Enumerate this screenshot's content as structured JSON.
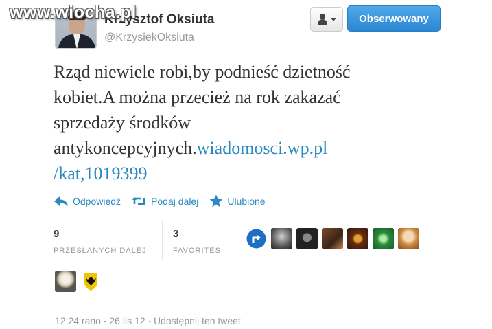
{
  "watermark": "www.wiocha.pl",
  "user": {
    "name": "Krzysztof Oksiuta",
    "handle": "@KrzysiekOksiuta"
  },
  "buttons": {
    "follow_label": "Obserwowany"
  },
  "icons": [
    "person-icon",
    "caret-down-icon",
    "reply-icon",
    "retweet-icon",
    "star-icon"
  ],
  "tweet": {
    "text": "Rząd niewiele robi,by podnieść dzietność kobiet.A można przecież na rok zakazać sprzedaży środków antykoncepcyjnych.",
    "link": "wiadomosci.wp.pl /kat,1019399"
  },
  "actions": {
    "reply": "Odpowiedź",
    "retweet": "Podaj dalej",
    "favorite": "Ulubione"
  },
  "stats": {
    "retweets": {
      "count": "9",
      "label": "PRZESŁANYCH DALEJ"
    },
    "favorites": {
      "count": "3",
      "label": "FAVORITES"
    }
  },
  "meta": "12:24 rano - 26 lis 12 · Udostępnij ten tweet",
  "colors": {
    "link": "#2a89c2",
    "follow_button": "#2b87d4"
  }
}
